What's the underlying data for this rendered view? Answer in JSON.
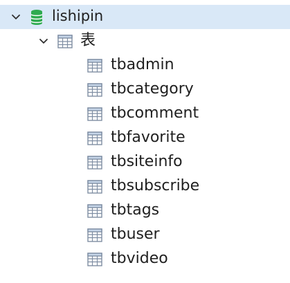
{
  "tree": {
    "database": {
      "label": "lishipin",
      "expanded": true,
      "icon": "database-icon",
      "selected": true
    },
    "group": {
      "label": "表",
      "expanded": true,
      "icon": "table-group-icon"
    },
    "tables": [
      {
        "label": "tbadmin",
        "icon": "table-icon"
      },
      {
        "label": "tbcategory",
        "icon": "table-icon"
      },
      {
        "label": "tbcomment",
        "icon": "table-icon"
      },
      {
        "label": "tbfavorite",
        "icon": "table-icon"
      },
      {
        "label": "tbsiteinfo",
        "icon": "table-icon"
      },
      {
        "label": "tbsubscribe",
        "icon": "table-icon"
      },
      {
        "label": "tbtags",
        "icon": "table-icon"
      },
      {
        "label": "tbuser",
        "icon": "table-icon"
      },
      {
        "label": "tbvideo",
        "icon": "table-icon"
      }
    ],
    "colors": {
      "selection": "#d9e8f7",
      "database_green": "#2eaa4f",
      "table_stroke": "#7f8ea3",
      "table_header": "#c6d5e8",
      "text": "#1f1f1f",
      "chevron": "#2f2f2f"
    }
  }
}
